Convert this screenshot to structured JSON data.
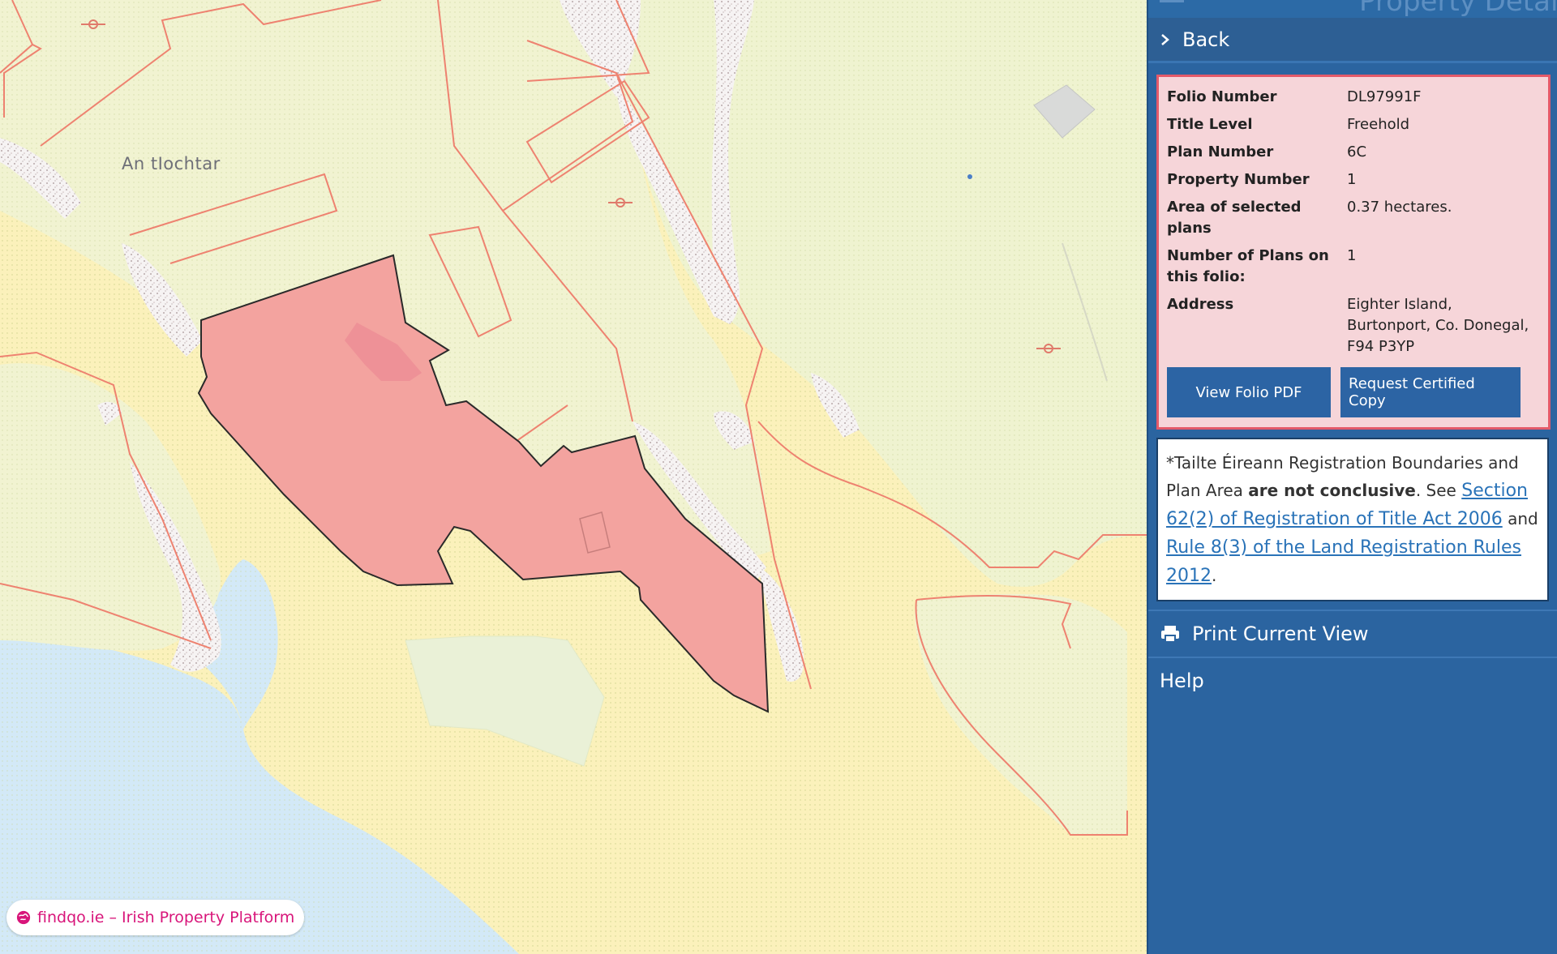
{
  "map": {
    "place_label": "An tIochtar",
    "watermark": "findqo.ie – Irish Property Platform"
  },
  "panel": {
    "header_title": "Property Details",
    "back_label": "Back",
    "details": [
      {
        "key": "Folio Number",
        "value": "DL97991F"
      },
      {
        "key": "Title Level",
        "value": "Freehold"
      },
      {
        "key": "Plan Number",
        "value": "6C"
      },
      {
        "key": "Property Number",
        "value": "1"
      },
      {
        "key": "Area of selected plans",
        "value": "0.37 hectares."
      },
      {
        "key": "Number of Plans on this folio:",
        "value": "1"
      },
      {
        "key": "Address",
        "value": "Eighter Island, Burtonport, Co. Donegal, F94 P3YP"
      }
    ],
    "buttons": {
      "view_pdf": "View Folio PDF",
      "request_copy": "Request Certified Copy"
    },
    "disclaimer": {
      "prefix": "*Tailte Éireann Registration Boundaries and Plan Area ",
      "bold": "are not conclusive",
      "middle": ". See ",
      "link1": "Section 62(2) of Registration of Title Act 2006",
      "and": " and ",
      "link2": "Rule 8(3) of the Land Registration Rules 2012",
      "suffix": "."
    },
    "print_label": "Print Current View",
    "help_label": "Help"
  },
  "colors": {
    "panel_bg": "#2b64a0",
    "selected_parcel": "#f3a4a0",
    "boundary": "#ee8270",
    "land": "#f0f3cf",
    "shore": "#fbf0b8",
    "water": "#cfe7f5",
    "watermark_text": "#d8157a"
  }
}
